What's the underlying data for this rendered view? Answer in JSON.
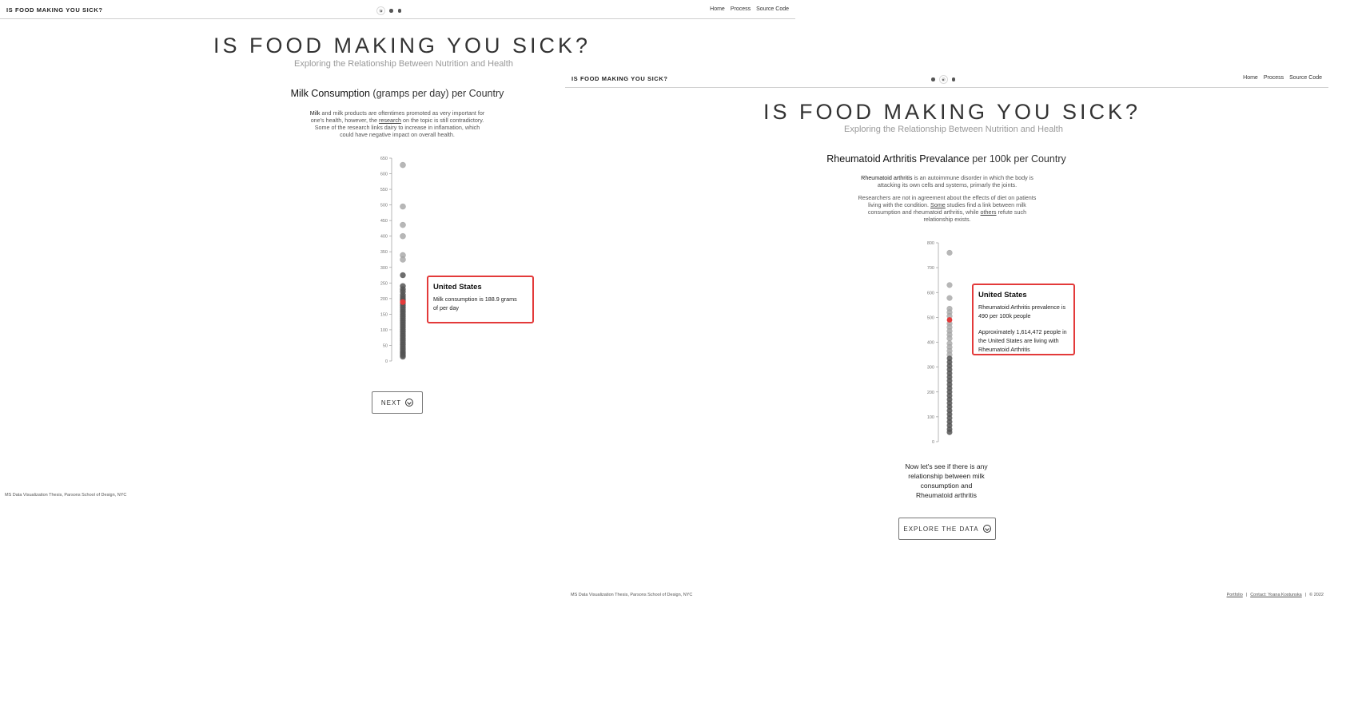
{
  "panel1": {
    "brand": "IS FOOD MAKING YOU SICK?",
    "nav": [
      "Home",
      "Process",
      "Source Code"
    ],
    "title": "IS FOOD MAKING YOU SICK?",
    "subtitle": "Exploring the Relationship Between Nutrition and Health",
    "chart_title_bold": "Milk Consumption",
    "chart_title_rest": " (gramps per day) per Country",
    "desc_bold": "Milk",
    "desc_1": " and milk products are oftentimes promoted as very important for",
    "desc_2": "one's health, however, the ",
    "desc_link": "research",
    "desc_3": " on the topic is still contradictory.",
    "desc_4": "Some of the research links dairy to increase in inflamation, which",
    "desc_5": "could have negative impact on overall health.",
    "tooltip": {
      "title": "United States",
      "line1": "Milk consumption is 188.9 grams",
      "line2": "of per day"
    },
    "button": "NEXT",
    "footer": "MS Data Visualization Thesis, Parsons School of Design, NYC"
  },
  "panel2": {
    "brand": "IS FOOD MAKING YOU SICK?",
    "nav": [
      "Home",
      "Process",
      "Source Code"
    ],
    "title": "IS FOOD MAKING YOU SICK?",
    "subtitle": "Exploring the Relationship Between Nutrition and Health",
    "chart_title_bold": "Rheumatoid Arthritis Prevalance",
    "chart_title_rest": " per 100k per Country",
    "desc_bold": "Rheumatoid arthritis",
    "desc_1": " is an autoimmune disorder in which the body is",
    "desc_2": "attacking its own cells and systems, primarly the joints.",
    "desc_3": "Researchers are not in agreement about the effects of diet on patients",
    "desc_4a": "living with the condition. ",
    "desc_link1": "Some",
    "desc_4b": " studies find a link between milk",
    "desc_5a": "consumption and rheumatoid arthritis, while ",
    "desc_link2": "others",
    "desc_5b": " refute such",
    "desc_6": "relationship exists.",
    "tooltip": {
      "title": "United States",
      "line1": "Rheumatoid Arthritis prevalence is",
      "line2": "490 per 100k people",
      "line3": "Approximately 1,614,472 people in",
      "line4": "the United States are living with",
      "line5": "Rheumatoid Arthritis"
    },
    "outro": [
      "Now let's see if there is any",
      "relationship between milk",
      "consumption and",
      "Rheumatoid arthritis"
    ],
    "button": "EXPLORE THE DATA",
    "footer": "MS Data Visualization Thesis, Parsons School of Design, NYC",
    "footer_links": [
      "Portfolio",
      "|",
      "Contact: Yoana Kostunska",
      "|",
      "© 2022"
    ]
  },
  "colors": {
    "highlight": "#e33a3a",
    "dot_light": "#aaaaaa",
    "dot_dark": "#555555"
  },
  "chart_data": [
    {
      "type": "scatter",
      "title": "Milk Consumption (gramps per day) per Country",
      "yticks": [
        0,
        50,
        100,
        150,
        200,
        250,
        300,
        350,
        400,
        450,
        500,
        550,
        600,
        650
      ],
      "ylim": [
        0,
        650
      ],
      "highlight": {
        "label": "United States",
        "value": 188.9
      },
      "values": [
        628,
        495,
        436,
        400,
        339,
        325,
        275,
        240,
        230,
        222,
        212,
        205,
        198,
        192,
        185,
        178,
        171,
        164,
        157,
        150,
        143,
        136,
        129,
        122,
        115,
        108,
        101,
        94,
        87,
        80,
        73,
        66,
        59,
        52,
        45,
        38,
        31,
        25,
        19,
        14
      ]
    },
    {
      "type": "scatter",
      "title": "Rheumatoid Arthritis Prevalance per 100k per Country",
      "yticks": [
        0,
        100,
        200,
        300,
        400,
        500,
        600,
        700,
        800
      ],
      "ylim": [
        0,
        800
      ],
      "highlight": {
        "label": "United States",
        "value": 490
      },
      "values": [
        760,
        630,
        578,
        535,
        520,
        505,
        475,
        460,
        445,
        430,
        415,
        395,
        380,
        365,
        350,
        335,
        320,
        305,
        290,
        275,
        260,
        245,
        230,
        215,
        200,
        185,
        170,
        155,
        140,
        125,
        110,
        95,
        80,
        65,
        50,
        38
      ]
    }
  ]
}
